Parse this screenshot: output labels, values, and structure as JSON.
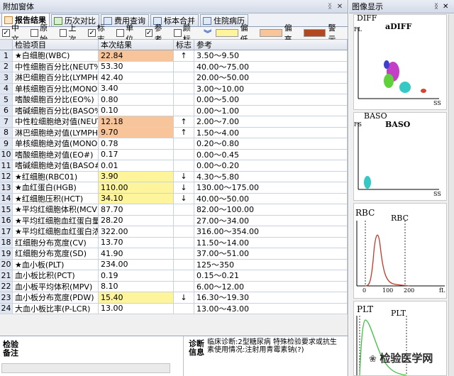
{
  "left_panel": {
    "title": "附加窗体",
    "tabs": [
      {
        "label": "报告结果"
      },
      {
        "label": "历次对比"
      },
      {
        "label": "费用查询"
      },
      {
        "label": "标本合并"
      },
      {
        "label": "住院病历"
      }
    ],
    "toolbar": {
      "checkboxes": [
        {
          "label": "中文",
          "checked": true
        },
        {
          "label": "原始",
          "checked": false
        },
        {
          "label": "上次",
          "checked": false
        },
        {
          "label": "标志",
          "checked": true
        },
        {
          "label": "单位",
          "checked": false
        },
        {
          "label": "参考",
          "checked": true
        },
        {
          "label": "颜标",
          "checked": false
        }
      ],
      "legend": [
        {
          "label": "偏低",
          "color": "#fef49c"
        },
        {
          "label": "偏高",
          "color": "#f8c49a"
        },
        {
          "label": "警示",
          "color": "#b3471f"
        }
      ]
    },
    "table": {
      "headers": [
        "检验项目",
        "本次结果",
        "标志",
        "参考"
      ],
      "rows": [
        {
          "no": "1",
          "name": "★白细胞(WBC)",
          "value": "22.84",
          "flag": "↑",
          "ref": "3.50～9.50",
          "level": "hi"
        },
        {
          "no": "2",
          "name": "中性细胞百分比(NEUT%)",
          "value": "53.30",
          "flag": "",
          "ref": "40.00～75.00",
          "level": ""
        },
        {
          "no": "3",
          "name": "淋巴细胞百分比(LYMPH%)",
          "value": "42.40",
          "flag": "",
          "ref": "20.00～50.00",
          "level": ""
        },
        {
          "no": "4",
          "name": "单核细胞百分比(MONO%)",
          "value": "3.40",
          "flag": "",
          "ref": "3.00～10.00",
          "level": ""
        },
        {
          "no": "5",
          "name": "嗜酸细胞百分比(EO%)",
          "value": "0.80",
          "flag": "",
          "ref": "0.00～5.00",
          "level": ""
        },
        {
          "no": "6",
          "name": "嗜碱细胞百分比(BASO%)",
          "value": "0.10",
          "flag": "",
          "ref": "0.00～1.00",
          "level": ""
        },
        {
          "no": "7",
          "name": "中性粒细胞绝对值(NEUT#)",
          "value": "12.18",
          "flag": "↑",
          "ref": "2.00～7.00",
          "level": "hi"
        },
        {
          "no": "8",
          "name": "淋巴细胞绝对值(LYMPH#)",
          "value": "9.70",
          "flag": "↑",
          "ref": "1.50～4.00",
          "level": "hi"
        },
        {
          "no": "9",
          "name": "单核细胞绝对值(MONO#)",
          "value": "0.78",
          "flag": "",
          "ref": "0.20～0.80",
          "level": ""
        },
        {
          "no": "10",
          "name": "嗜酸细胞绝对值(EO#)",
          "value": "0.17",
          "flag": "",
          "ref": "0.00～0.45",
          "level": ""
        },
        {
          "no": "11",
          "name": "嗜碱细胞绝对值(BASO#)",
          "value": "0.01",
          "flag": "",
          "ref": "0.00～0.20",
          "level": ""
        },
        {
          "no": "12",
          "name": "★红细胞(RBC01)",
          "value": "3.90",
          "flag": "↓",
          "ref": "4.30～5.80",
          "level": "lo"
        },
        {
          "no": "13",
          "name": "★血红蛋白(HGB)",
          "value": "110.00",
          "flag": "↓",
          "ref": "130.00～175.00",
          "level": "lo"
        },
        {
          "no": "14",
          "name": "★红细胞压积(HCT)",
          "value": "34.10",
          "flag": "↓",
          "ref": "40.00～50.00",
          "level": "lo"
        },
        {
          "no": "15",
          "name": "★平均红细胞体积(MCV)",
          "value": "87.70",
          "flag": "",
          "ref": "82.00～100.00",
          "level": ""
        },
        {
          "no": "16",
          "name": "★平均红细胞血红蛋白量",
          "value": "28.20",
          "flag": "",
          "ref": "27.00～34.00",
          "level": ""
        },
        {
          "no": "17",
          "name": "★平均红细胞血红蛋白浓度",
          "value": "322.00",
          "flag": "",
          "ref": "316.00～354.00",
          "level": ""
        },
        {
          "no": "18",
          "name": "红细胞分布宽度(CV)",
          "value": "13.70",
          "flag": "",
          "ref": "11.50～14.00",
          "level": ""
        },
        {
          "no": "19",
          "name": "红细胞分布宽度(SD)",
          "value": "41.90",
          "flag": "",
          "ref": "37.00～51.00",
          "level": ""
        },
        {
          "no": "20",
          "name": "★血小板(PLT)",
          "value": "234.00",
          "flag": "",
          "ref": "125～350",
          "level": ""
        },
        {
          "no": "21",
          "name": "血小板比积(PCT)",
          "value": "0.19",
          "flag": "",
          "ref": "0.15～0.21",
          "level": ""
        },
        {
          "no": "22",
          "name": "血小板平均体积(MPV)",
          "value": "8.10",
          "flag": "",
          "ref": "6.00～12.00",
          "level": ""
        },
        {
          "no": "23",
          "name": "血小板分布宽度(PDW)",
          "value": "15.40",
          "flag": "↓",
          "ref": "16.30～19.30",
          "level": "lo"
        },
        {
          "no": "24",
          "name": "大血小板比率(P-LCR)",
          "value": "13.00",
          "flag": "",
          "ref": "13.00～43.00",
          "level": ""
        }
      ]
    },
    "bottom": {
      "remark_label": "检验备注",
      "diag_label": "诊断信息",
      "diag_text": "临床诊断:2型糖尿病 特殊检验要求或抗生素使用情况:注射用青霉素钠(?)"
    }
  },
  "right_panel": {
    "title": "图像显示",
    "graphs": [
      {
        "title": "aDIFF",
        "side": "DIFF",
        "yaxis": "FL",
        "xaxis": "SS"
      },
      {
        "title": "BASO",
        "side": "BASO",
        "yaxis": "FS",
        "xaxis": "SS"
      },
      {
        "title": "RBC",
        "side": "RBC",
        "xticks": [
          "0",
          "100",
          "200"
        ],
        "xunit": "fL"
      },
      {
        "title": "PLT",
        "side": "PLT"
      }
    ]
  },
  "watermark": "检验医学网"
}
